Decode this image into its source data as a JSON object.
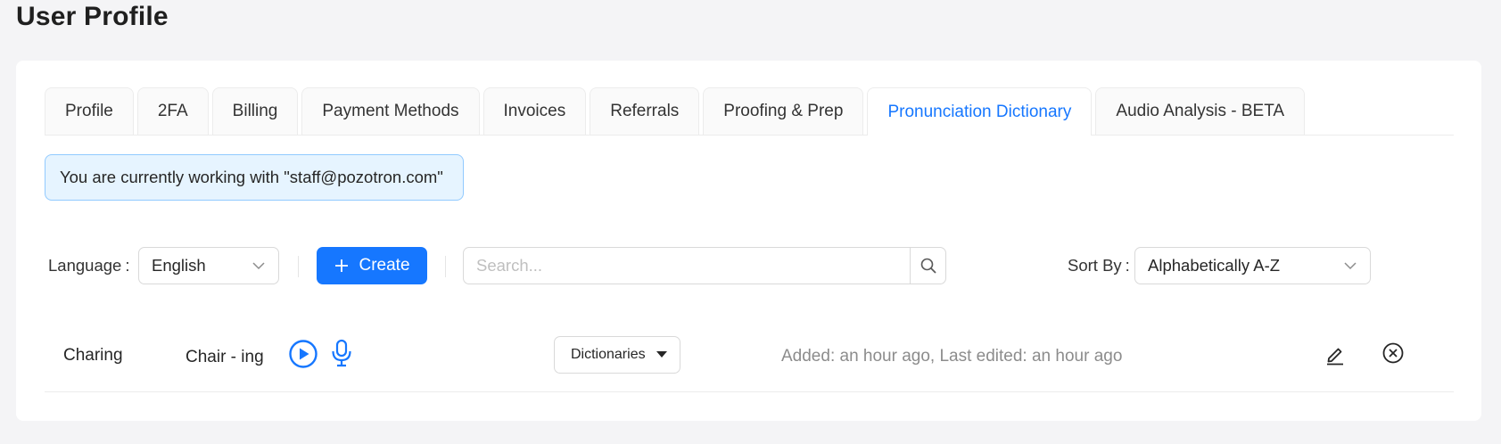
{
  "page": {
    "title": "User Profile"
  },
  "tabs": [
    {
      "label": "Profile",
      "active": false
    },
    {
      "label": "2FA",
      "active": false
    },
    {
      "label": "Billing",
      "active": false
    },
    {
      "label": "Payment Methods",
      "active": false
    },
    {
      "label": "Invoices",
      "active": false
    },
    {
      "label": "Referrals",
      "active": false
    },
    {
      "label": "Proofing & Prep",
      "active": false
    },
    {
      "label": "Pronunciation Dictionary",
      "active": true
    },
    {
      "label": "Audio Analysis - BETA",
      "active": false
    }
  ],
  "alert": {
    "text": "You are currently working with \"staff@pozotron.com\""
  },
  "toolbar": {
    "language_label": "Language",
    "language_value": "English",
    "create_label": "Create",
    "search_placeholder": "Search...",
    "sort_label": "Sort By",
    "sort_value": "Alphabetically A-Z"
  },
  "entries": [
    {
      "word": "Charing",
      "pronunciation": "Chair - ing",
      "dictionaries_label": "Dictionaries",
      "meta": "Added: an hour ago, Last edited: an hour ago"
    }
  ],
  "colors": {
    "accent": "#1677ff",
    "alert_bg": "#e6f4ff",
    "alert_border": "#91caff",
    "muted_text": "#8c8c8c"
  },
  "icons": [
    "plus-icon",
    "search-icon",
    "chevron-down-icon",
    "play-circle-icon",
    "microphone-icon",
    "caret-down-icon",
    "edit-icon",
    "close-circle-icon"
  ]
}
